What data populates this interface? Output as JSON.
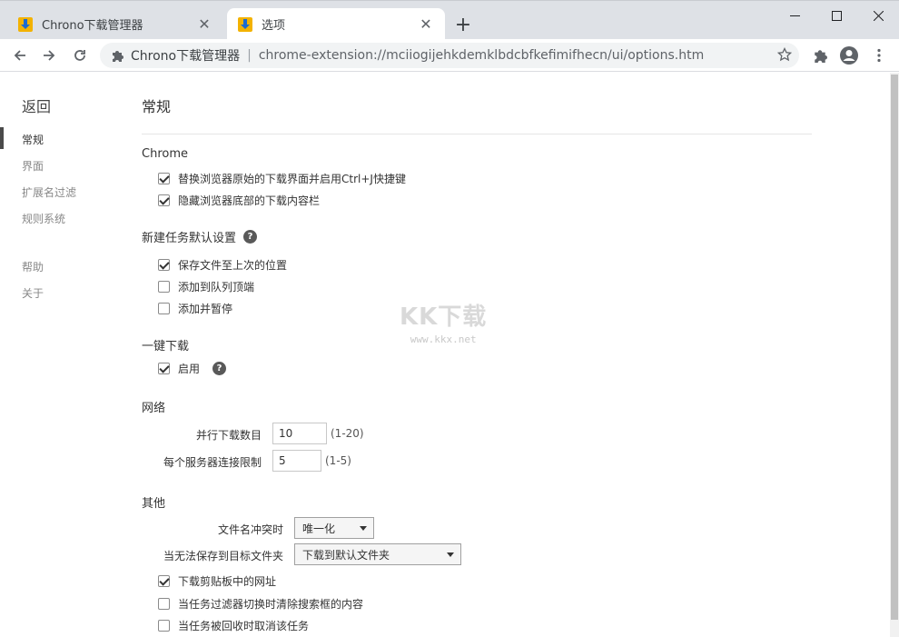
{
  "browser": {
    "tabs": [
      {
        "title": "Chrono下载管理器",
        "active": false
      },
      {
        "title": "选项",
        "active": true
      }
    ],
    "omnibox": {
      "site_label": "Chrono下载管理器",
      "url": "chrome-extension://mciiogijehkdemklbdcbfkefimifhecn/ui/options.htm"
    }
  },
  "sidebar": {
    "back": "返回",
    "items": [
      {
        "label": "常规",
        "active": true
      },
      {
        "label": "界面",
        "active": false
      },
      {
        "label": "扩展名过滤",
        "active": false
      },
      {
        "label": "规则系统",
        "active": false
      },
      {
        "label": "帮助",
        "active": false
      },
      {
        "label": "关于",
        "active": false
      }
    ]
  },
  "main": {
    "title": "常规",
    "chrome": {
      "heading": "Chrome",
      "options": [
        {
          "label": "替换浏览器原始的下载界面并启用Ctrl+J快捷键",
          "checked": true
        },
        {
          "label": "隐藏浏览器底部的下载内容栏",
          "checked": true
        }
      ]
    },
    "new_task": {
      "heading": "新建任务默认设置",
      "options": [
        {
          "label": "保存文件至上次的位置",
          "checked": true
        },
        {
          "label": "添加到队列顶端",
          "checked": false
        },
        {
          "label": "添加并暂停",
          "checked": false
        }
      ]
    },
    "one_click": {
      "heading": "一键下载",
      "enable_label": "启用",
      "enabled": true
    },
    "network": {
      "heading": "网络",
      "parallel_label": "并行下载数目",
      "parallel_value": "10",
      "parallel_range": "(1-20)",
      "per_server_label": "每个服务器连接限制",
      "per_server_value": "5",
      "per_server_range": "(1-5)"
    },
    "other": {
      "heading": "其他",
      "conflict_label": "文件名冲突时",
      "conflict_value": "唯一化",
      "unsavable_label": "当无法保存到目标文件夹",
      "unsavable_value": "下载到默认文件夹",
      "options": [
        {
          "label": "下载剪贴板中的网址",
          "checked": true
        },
        {
          "label": "当任务过滤器切换时清除搜索框的内容",
          "checked": false
        },
        {
          "label": "当任务被回收时取消该任务",
          "checked": false
        }
      ]
    }
  },
  "watermark": {
    "logo": "KK下载",
    "url": "www.kkx.net"
  },
  "colors": {
    "tabstrip": "#dee1e6",
    "accent_icon": "#f3b200",
    "active_nav_bar": "#4a4a4a"
  }
}
